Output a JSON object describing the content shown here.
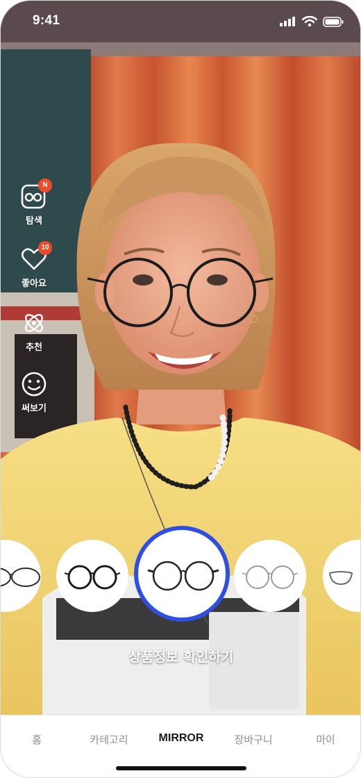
{
  "status_bar": {
    "time": "9:41"
  },
  "side_menu": [
    {
      "id": "explore",
      "label": "탐색",
      "icon": "glasses-search-icon",
      "badge": "N"
    },
    {
      "id": "likes",
      "label": "좋아요",
      "icon": "heart-icon",
      "badge": "10"
    },
    {
      "id": "recommend",
      "label": "추천",
      "icon": "atom-icon",
      "badge": ""
    },
    {
      "id": "try_on",
      "label": "써보기",
      "icon": "smiley-face-icon",
      "badge": ""
    }
  ],
  "carousel": {
    "selected_index": 2,
    "frames": [
      {
        "name": "rimless-frame",
        "color": "#2a2a2a"
      },
      {
        "name": "black-round-frame",
        "color": "#1b1b1b"
      },
      {
        "name": "black-metal-round-frame",
        "color": "#262626"
      },
      {
        "name": "silver-round-frame",
        "color": "#9a9a9a"
      },
      {
        "name": "half-rim-frame",
        "color": "#6b6b6b"
      }
    ]
  },
  "product_info_button": "상품정보 확인하기",
  "bottom_nav": {
    "active": "mirror",
    "items": [
      {
        "id": "home",
        "label": "홈"
      },
      {
        "id": "category",
        "label": "카테고리"
      },
      {
        "id": "mirror",
        "label": "MIRROR"
      },
      {
        "id": "cart",
        "label": "장바구니"
      },
      {
        "id": "my",
        "label": "마이"
      }
    ]
  },
  "colors": {
    "accent": "#2f4fe3",
    "badge": "#f04b2c",
    "curtain": "#d9663c",
    "sweater": "#f3d873"
  }
}
